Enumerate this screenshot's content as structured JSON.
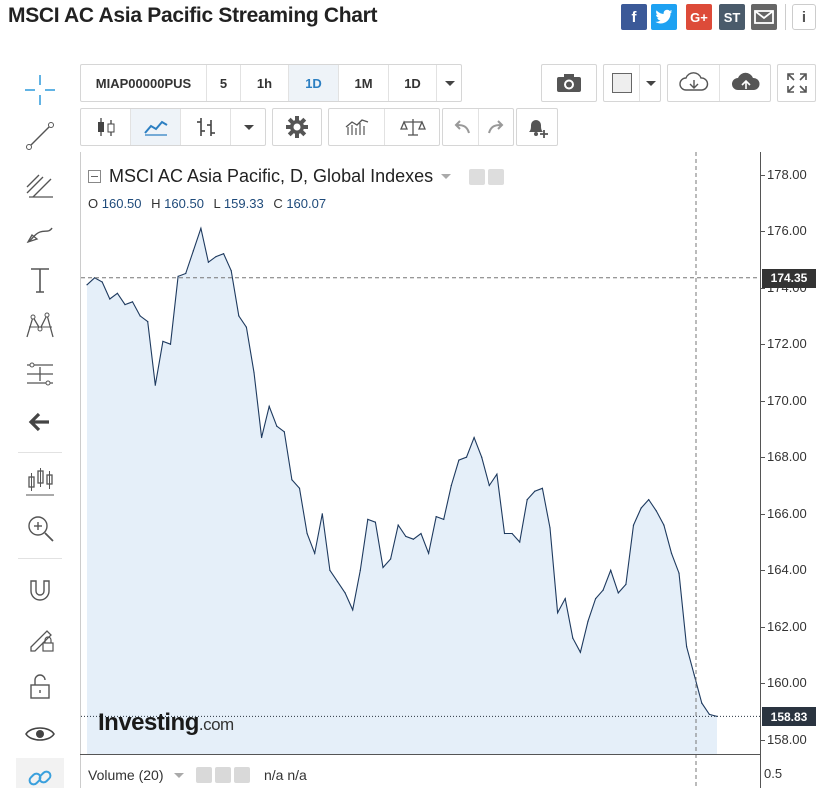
{
  "page_title": "MSCI AC Asia Pacific Streaming Chart",
  "share": {
    "facebook": "f",
    "twitter": "t",
    "googleplus": "G+",
    "stocktwits": "ST",
    "email": "email",
    "info": "i"
  },
  "toolbar": {
    "symbol": "MIAP00000PUS",
    "intervals": [
      "5",
      "1h",
      "1D",
      "1M",
      "1D"
    ],
    "active_interval": "1D"
  },
  "legend": {
    "title": "MSCI AC Asia Pacific, D, Global Indexes",
    "o_label": "O",
    "o_value": "160.50",
    "h_label": "H",
    "h_value": "160.50",
    "l_label": "L",
    "l_value": "159.33",
    "c_label": "C",
    "c_value": "160.07"
  },
  "crosshair_price": "174.35",
  "last_price": "158.83",
  "watermark": {
    "brand": "Investing",
    "suffix": ".com"
  },
  "volume": {
    "label": "Volume (20)",
    "values": "n/a  n/a",
    "axis_tick": "0.5"
  },
  "colors": {
    "line": "#1e3a5f",
    "area": "#dce9f7",
    "crosshair_tag": "#333333",
    "last_price_tag": "#2a3440",
    "facebook": "#3b5998",
    "twitter": "#1da1f2",
    "googleplus": "#dd4b39",
    "stocktwits": "#4a5b6b",
    "email": "#666666"
  },
  "chart_data": {
    "type": "area",
    "title": "MSCI AC Asia Pacific, D, Global Indexes",
    "xlabel": "",
    "ylabel": "",
    "ylim": [
      157.5,
      178.8
    ],
    "yticks": [
      "178.00",
      "176.00",
      "174.00",
      "172.00",
      "170.00",
      "168.00",
      "166.00",
      "164.00",
      "162.00",
      "160.00",
      "158.00"
    ],
    "grid": false,
    "values": [
      174.1,
      174.35,
      174.2,
      173.6,
      173.8,
      173.4,
      173.5,
      173.0,
      172.8,
      170.55,
      172.1,
      172.0,
      174.4,
      174.5,
      175.3,
      176.1,
      174.9,
      175.1,
      175.2,
      174.6,
      173.0,
      172.6,
      171.0,
      168.7,
      169.8,
      169.1,
      168.9,
      167.2,
      166.9,
      165.3,
      164.6,
      166.0,
      164.0,
      163.6,
      163.2,
      162.6,
      164.0,
      165.8,
      165.7,
      164.1,
      164.4,
      165.6,
      165.2,
      165.1,
      165.3,
      164.6,
      165.9,
      165.8,
      167.0,
      167.9,
      168.0,
      168.7,
      168.0,
      167.0,
      167.4,
      165.3,
      165.3,
      165.0,
      166.5,
      166.8,
      166.9,
      165.5,
      162.5,
      163.0,
      161.6,
      161.1,
      162.2,
      163.0,
      163.3,
      164.0,
      163.2,
      163.5,
      165.6,
      166.2,
      166.5,
      166.1,
      165.6,
      164.6,
      163.9,
      161.3,
      160.3,
      159.3,
      158.9,
      158.83
    ]
  }
}
